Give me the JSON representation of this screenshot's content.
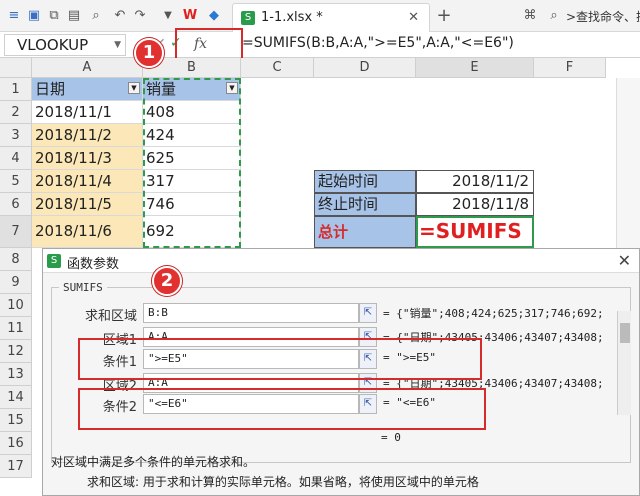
{
  "toolbar": {
    "file_tab": "1-1.xlsx *",
    "search_placeholder": ">查找命令、搜"
  },
  "formula_bar": {
    "name_box": "VLOOKUP",
    "fx_label": "fx",
    "formula": "=SUMIFS(B:B,A:A,\">=E5\",A:A,\"<=E6\")"
  },
  "sheet": {
    "columns": [
      "A",
      "B",
      "C",
      "D",
      "E",
      "F"
    ],
    "rows": [
      "1",
      "2",
      "3",
      "4",
      "5",
      "6",
      "7",
      "8",
      "9",
      "10",
      "11",
      "12",
      "13",
      "14",
      "15",
      "16",
      "17"
    ],
    "header": {
      "a": "日期",
      "b": "销量"
    },
    "data": [
      {
        "date": "2018/11/1",
        "sales": "408"
      },
      {
        "date": "2018/11/2",
        "sales": "424"
      },
      {
        "date": "2018/11/3",
        "sales": "625"
      },
      {
        "date": "2018/11/4",
        "sales": "317"
      },
      {
        "date": "2018/11/5",
        "sales": "746"
      },
      {
        "date": "2018/11/6",
        "sales": "692"
      }
    ],
    "info": {
      "start_label": "起始时间",
      "start_value": "2018/11/2",
      "end_label": "终止时间",
      "end_value": "2018/11/8",
      "total_label": "总计",
      "total_value": "=SUMIFS"
    }
  },
  "dialog": {
    "title": "函数参数",
    "function_name": "SUMIFS",
    "args": [
      {
        "label": "求和区域",
        "value": "B:B",
        "result": "= {\"销量\";408;424;625;317;746;692;…"
      },
      {
        "label": "区域1",
        "value": "A:A",
        "result": "= {\"日期\";43405;43406;43407;43408;…"
      },
      {
        "label": "条件1",
        "value": "\">=E5\"",
        "result": "= \">=E5\""
      },
      {
        "label": "区域2",
        "value": "A:A",
        "result": "= {\"日期\";43405;43406;43407;43408;…"
      },
      {
        "label": "条件2",
        "value": "\"<=E6\"",
        "result": "= \"<=E6\""
      }
    ],
    "result": "= 0",
    "description": "对区域中满足多个条件的单元格求和。",
    "arg_help": "求和区域:  用于求和计算的实际单元格。如果省略，将使用区域中的单元格"
  },
  "badges": [
    "1",
    "2"
  ],
  "colors": {
    "accent_red": "#e03030",
    "header_blue": "#a7c3e8",
    "date_yellow": "#fbe7b7",
    "selection_green": "#2e9a4a"
  }
}
